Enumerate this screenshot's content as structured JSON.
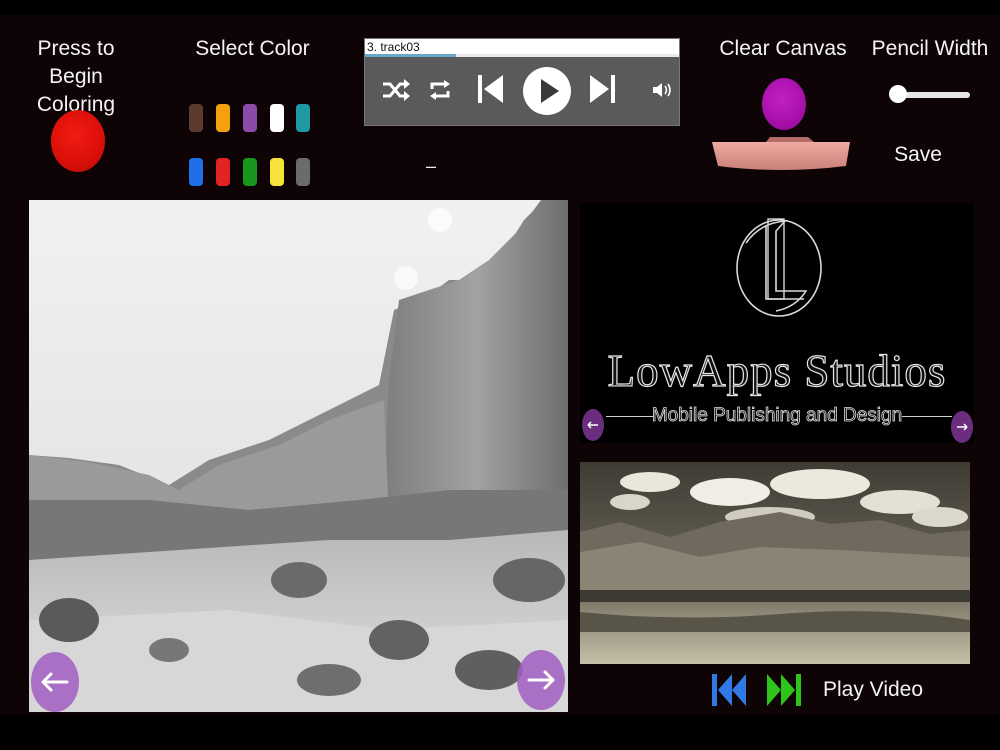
{
  "header": {
    "begin_label": "Press to Begin Coloring",
    "select_color_label": "Select Color",
    "clear_canvas_label": "Clear Canvas",
    "pencil_width_label": "Pencil Width",
    "save_label": "Save",
    "dash": "–"
  },
  "palette": {
    "row1": [
      "#5c3a2e",
      "#f5a10f",
      "#8e4aa8",
      "#ffffff",
      "#1f9aa5"
    ],
    "row2": [
      "#1f6fe8",
      "#e22323",
      "#18961d",
      "#f5e23a",
      "#6b6b6b"
    ]
  },
  "player": {
    "track_title": "3.  track03",
    "progress": 0.29,
    "icons": [
      "shuffle-icon",
      "repeat-icon",
      "skip-back-icon",
      "play-icon",
      "skip-forward-icon",
      "volume-icon"
    ]
  },
  "logo": {
    "title": "LowApps Studios",
    "subtitle": "Mobile Publishing and Design"
  },
  "video": {
    "play_label": "Play Video"
  },
  "pencil_width": {
    "value": 0.05
  }
}
